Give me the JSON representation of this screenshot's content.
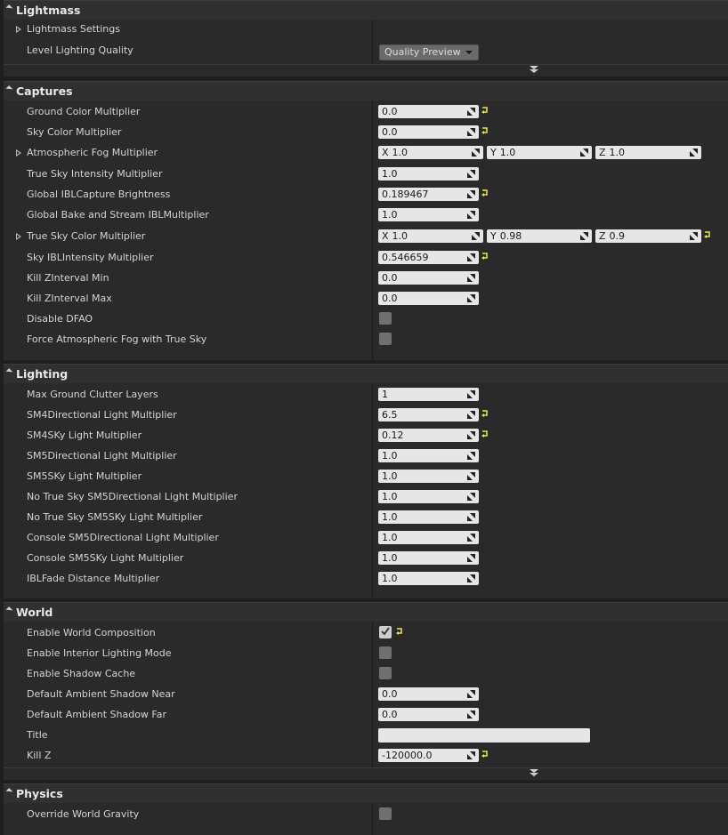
{
  "colors": {
    "panel_bg": "#2a2a2a",
    "header_bg": "#303030",
    "reset_arrow": "#e8e84a",
    "field_bg": "#e6e6e6"
  },
  "icons": {
    "collapse": "triangle-down-icon",
    "expand": "triangle-right-icon",
    "reset": "reset-to-default-icon",
    "spin": "drag-spin-icon",
    "advanced": "show-advanced-chevron-icon"
  },
  "lightmass": {
    "title": "Lightmass",
    "settings_label": "Lightmass Settings",
    "quality_label": "Level Lighting Quality",
    "quality_value": "Quality Preview"
  },
  "captures": {
    "title": "Captures",
    "ground_color": {
      "label": "Ground Color Multiplier",
      "value": "0.0"
    },
    "sky_color": {
      "label": "Sky Color Multiplier",
      "value": "0.0"
    },
    "atmo_fog": {
      "label": "Atmospheric Fog Multiplier",
      "x": "1.0",
      "y": "1.0",
      "z": "1.0"
    },
    "true_sky_intensity": {
      "label": "True Sky Intensity Multiplier",
      "value": "1.0"
    },
    "global_ibl_brightness": {
      "label": "Global IBLCapture Brightness",
      "value": "0.189467"
    },
    "global_bake": {
      "label": "Global Bake and Stream IBLMultiplier",
      "value": "1.0"
    },
    "true_sky_color": {
      "label": "True Sky Color Multiplier",
      "x": "1.0",
      "y": "0.98",
      "z": "0.9"
    },
    "sky_ibl_intensity": {
      "label": "Sky IBLIntensity Multiplier",
      "value": "0.546659"
    },
    "kill_zmin": {
      "label": "Kill ZInterval Min",
      "value": "0.0"
    },
    "kill_zmax": {
      "label": "Kill ZInterval Max",
      "value": "0.0"
    },
    "disable_dfao": {
      "label": "Disable DFAO"
    },
    "force_atmo_fog": {
      "label": "Force Atmospheric Fog with True Sky"
    }
  },
  "axis": {
    "x": "X",
    "y": "Y",
    "z": "Z"
  },
  "lighting": {
    "title": "Lighting",
    "rows": [
      {
        "label": "Max Ground Clutter Layers",
        "value": "1",
        "reset": false
      },
      {
        "label": "SM4Directional Light Multiplier",
        "value": "6.5",
        "reset": true
      },
      {
        "label": "SM4SKy Light Multiplier",
        "value": "0.12",
        "reset": true
      },
      {
        "label": "SM5Directional Light Multiplier",
        "value": "1.0",
        "reset": false
      },
      {
        "label": "SM5SKy Light Multiplier",
        "value": "1.0",
        "reset": false
      },
      {
        "label": "No True Sky SM5Directional Light Multiplier",
        "value": "1.0",
        "reset": false
      },
      {
        "label": "No True Sky SM5SKy Light Multiplier",
        "value": "1.0",
        "reset": false
      },
      {
        "label": "Console SM5Directional Light Multiplier",
        "value": "1.0",
        "reset": false
      },
      {
        "label": "Console SM5SKy Light Multiplier",
        "value": "1.0",
        "reset": false
      },
      {
        "label": "IBLFade Distance Multiplier",
        "value": "1.0",
        "reset": false
      }
    ]
  },
  "world": {
    "title": "World",
    "world_composition": {
      "label": "Enable World Composition"
    },
    "interior_lighting": {
      "label": "Enable Interior Lighting Mode"
    },
    "shadow_cache": {
      "label": "Enable Shadow Cache"
    },
    "ambient_near": {
      "label": "Default Ambient Shadow Near",
      "value": "0.0"
    },
    "ambient_far": {
      "label": "Default Ambient Shadow Far",
      "value": "0.0"
    },
    "title_field": {
      "label": "Title",
      "value": ""
    },
    "kill_z": {
      "label": "Kill Z",
      "value": "-120000.0"
    }
  },
  "physics": {
    "title": "Physics",
    "override_gravity": {
      "label": "Override World Gravity"
    }
  }
}
